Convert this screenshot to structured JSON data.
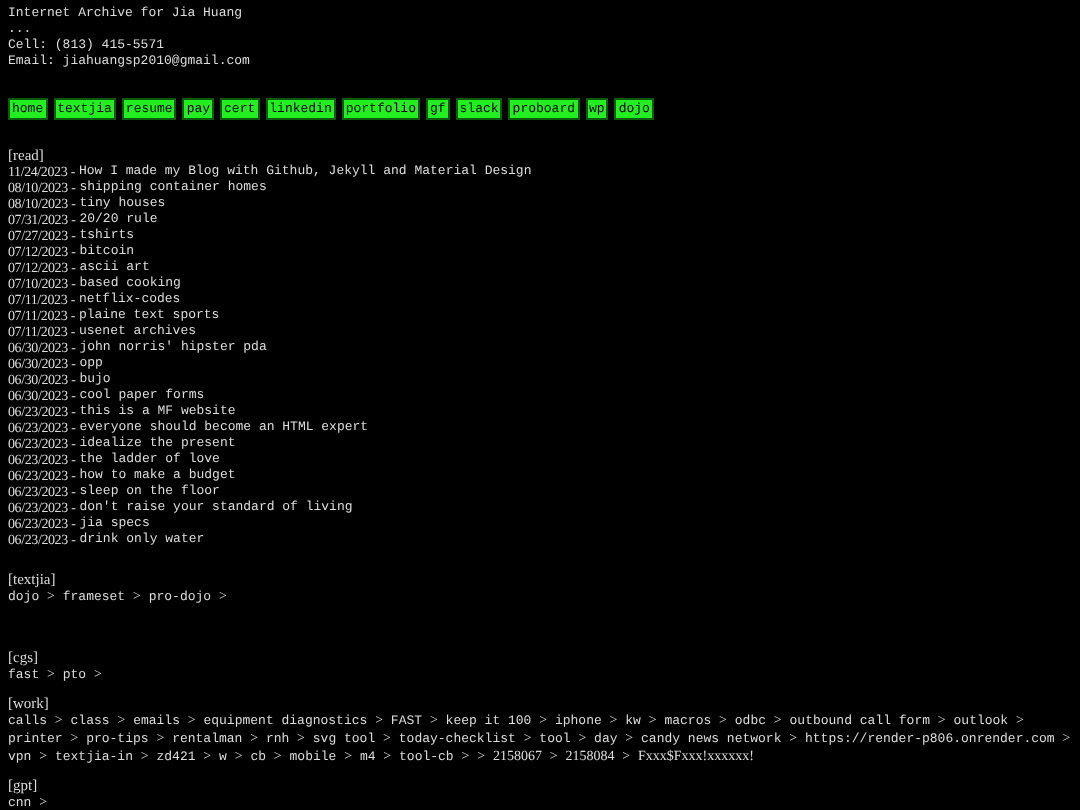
{
  "header": {
    "title": "Internet Archive for Jia Huang",
    "lines": [
      "...",
      "Cell: (813) 415-5571",
      "Email: jiahuangsp2010@gmail.com"
    ]
  },
  "nav": [
    "home",
    "textjia",
    "resume",
    "pay",
    "cert",
    "linkedin",
    "portfolio",
    "gf",
    "slack",
    "proboard",
    "wp",
    "dojo"
  ],
  "read": {
    "heading": "[read]",
    "posts": [
      {
        "date": "11/24/2023",
        "sep": "-",
        "title": "How I made my Blog with Github, Jekyll and Material Design"
      },
      {
        "date": "08/10/2023",
        "sep": "-",
        "title": "shipping container homes"
      },
      {
        "date": "08/10/2023",
        "sep": "-",
        "title": "tiny houses"
      },
      {
        "date": "07/31/2023",
        "sep": "-",
        "title": "20/20 rule"
      },
      {
        "date": "07/27/2023",
        "sep": "-",
        "title": "tshirts"
      },
      {
        "date": "07/12/2023",
        "sep": "-",
        "title": "bitcoin"
      },
      {
        "date": "07/12/2023",
        "sep": "-",
        "title": "ascii art"
      },
      {
        "date": "07/10/2023",
        "sep": "-",
        "title": "based cooking"
      },
      {
        "date": "07/11/2023",
        "sep": "-",
        "title": "netflix-codes"
      },
      {
        "date": "07/11/2023",
        "sep": "-",
        "title": "plaine text sports"
      },
      {
        "date": "07/11/2023",
        "sep": "-",
        "title": "usenet archives"
      },
      {
        "date": "06/30/2023",
        "sep": "-",
        "title": "john norris' hipster pda"
      },
      {
        "date": "06/30/2023",
        "sep": "-",
        "title": "opp"
      },
      {
        "date": "06/30/2023",
        "sep": "-",
        "title": "bujo"
      },
      {
        "date": "06/30/2023",
        "sep": "-",
        "title": "cool paper forms"
      },
      {
        "date": "06/23/2023",
        "sep": "-",
        "title": "this is a MF website"
      },
      {
        "date": "06/23/2023",
        "sep": "-",
        "title": "everyone should become an HTML expert"
      },
      {
        "date": "06/23/2023",
        "sep": "-",
        "title": "idealize the present"
      },
      {
        "date": "06/23/2023",
        "sep": "-",
        "title": "the ladder of love"
      },
      {
        "date": "06/23/2023",
        "sep": "-",
        "title": "how to make a budget"
      },
      {
        "date": "06/23/2023",
        "sep": "-",
        "title": "sleep on the floor"
      },
      {
        "date": "06/23/2023",
        "sep": "-",
        "title": "don't raise your standard of living"
      },
      {
        "date": "06/23/2023",
        "sep": "-",
        "title": "jia specs"
      },
      {
        "date": "06/23/2023",
        "sep": "-",
        "title": "drink only water"
      }
    ]
  },
  "sections": [
    {
      "heading": "[textjia]",
      "items": [
        {
          "kind": "link",
          "text": "dojo"
        },
        {
          "kind": "sep",
          "text": ">"
        },
        {
          "kind": "link",
          "text": "frameset"
        },
        {
          "kind": "sep",
          "text": ">"
        },
        {
          "kind": "link",
          "text": "pro-dojo"
        },
        {
          "kind": "sep",
          "text": ">"
        }
      ]
    },
    {
      "heading": "[cgs]",
      "items": [
        {
          "kind": "link",
          "text": "fast"
        },
        {
          "kind": "sep",
          "text": ">"
        },
        {
          "kind": "link",
          "text": "pto"
        },
        {
          "kind": "sep",
          "text": ">"
        }
      ]
    },
    {
      "heading": "[work]",
      "items": [
        {
          "kind": "link",
          "text": "calls"
        },
        {
          "kind": "sep",
          "text": ">"
        },
        {
          "kind": "link",
          "text": "class"
        },
        {
          "kind": "sep",
          "text": ">"
        },
        {
          "kind": "link",
          "text": "emails"
        },
        {
          "kind": "sep",
          "text": ">"
        },
        {
          "kind": "link",
          "text": "equipment diagnostics"
        },
        {
          "kind": "sep",
          "text": ">"
        },
        {
          "kind": "link",
          "text": "FAST"
        },
        {
          "kind": "sep",
          "text": ">"
        },
        {
          "kind": "link",
          "text": "keep it 100"
        },
        {
          "kind": "sep",
          "text": ">"
        },
        {
          "kind": "link",
          "text": "iphone"
        },
        {
          "kind": "sep",
          "text": ">"
        },
        {
          "kind": "link",
          "text": "kw"
        },
        {
          "kind": "sep",
          "text": ">"
        },
        {
          "kind": "link",
          "text": "macros"
        },
        {
          "kind": "sep",
          "text": ">"
        },
        {
          "kind": "link",
          "text": "odbc"
        },
        {
          "kind": "sep",
          "text": ">"
        },
        {
          "kind": "link",
          "text": "outbound call form"
        },
        {
          "kind": "sep",
          "text": ">"
        },
        {
          "kind": "link",
          "text": "outlook"
        },
        {
          "kind": "sep",
          "text": ">"
        },
        {
          "kind": "link",
          "text": "printer"
        },
        {
          "kind": "sep",
          "text": ">"
        },
        {
          "kind": "link",
          "text": "pro-tips"
        },
        {
          "kind": "sep",
          "text": ">"
        },
        {
          "kind": "link",
          "text": "rentalman"
        },
        {
          "kind": "sep",
          "text": ">"
        },
        {
          "kind": "link",
          "text": "rnh"
        },
        {
          "kind": "sep",
          "text": ">"
        },
        {
          "kind": "link",
          "text": "svg tool"
        },
        {
          "kind": "sep",
          "text": ">"
        },
        {
          "kind": "link",
          "text": "today-checklist"
        },
        {
          "kind": "sep",
          "text": ">"
        },
        {
          "kind": "link",
          "text": "tool"
        },
        {
          "kind": "sep",
          "text": ">"
        },
        {
          "kind": "link",
          "text": "day"
        },
        {
          "kind": "sep",
          "text": ">"
        },
        {
          "kind": "link",
          "text": "candy news network"
        },
        {
          "kind": "sep",
          "text": ">"
        },
        {
          "kind": "link",
          "text": "https://render-p806.onrender.com"
        },
        {
          "kind": "sep",
          "text": ">"
        },
        {
          "kind": "link",
          "text": "vpn"
        },
        {
          "kind": "sep",
          "text": ">"
        },
        {
          "kind": "link",
          "text": "textjia-in"
        },
        {
          "kind": "sep",
          "text": ">"
        },
        {
          "kind": "link",
          "text": "zd421"
        },
        {
          "kind": "sep",
          "text": ">"
        },
        {
          "kind": "link",
          "text": "w"
        },
        {
          "kind": "sep",
          "text": ">"
        },
        {
          "kind": "link",
          "text": "cb"
        },
        {
          "kind": "sep",
          "text": ">"
        },
        {
          "kind": "link",
          "text": "mobile"
        },
        {
          "kind": "sep",
          "text": ">"
        },
        {
          "kind": "link",
          "text": "m4"
        },
        {
          "kind": "sep",
          "text": ">"
        },
        {
          "kind": "link",
          "text": "tool-cb"
        },
        {
          "kind": "sep",
          "text": ">"
        },
        {
          "kind": "sep",
          "text": ">"
        },
        {
          "kind": "plain",
          "text": "2158067"
        },
        {
          "kind": "sep",
          "text": ">"
        },
        {
          "kind": "plain",
          "text": "2158084"
        },
        {
          "kind": "sep",
          "text": ">"
        },
        {
          "kind": "plain",
          "text": "Fxxx$Fxxx!xxxxxx!"
        }
      ]
    },
    {
      "heading": "[gpt]",
      "items": [
        {
          "kind": "link",
          "text": "cnn"
        },
        {
          "kind": "sep",
          "text": ">"
        }
      ]
    }
  ]
}
